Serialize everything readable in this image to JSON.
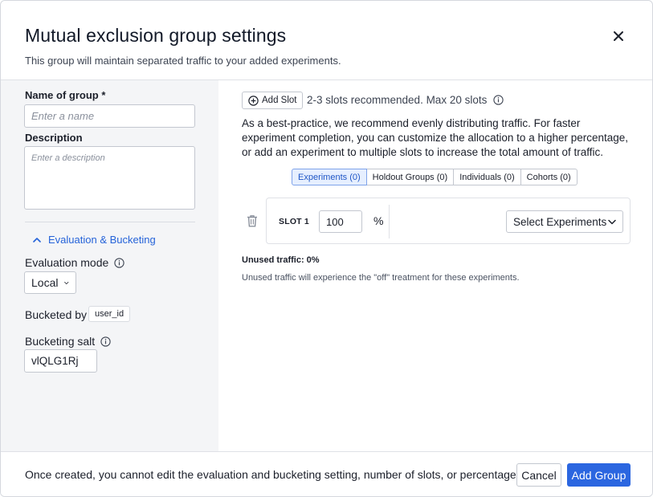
{
  "dialog": {
    "title": "Mutual exclusion group settings",
    "subtitle": "This group will maintain separated traffic to your added experiments.",
    "close_icon": "close-icon"
  },
  "left_panel": {
    "name_label": "Name of group *",
    "name_value": "",
    "name_placeholder": "Enter a name",
    "description_label": "Description",
    "description_value": "",
    "description_placeholder": "Enter a description",
    "section_toggle_label": "Evaluation & Bucketing",
    "section_toggle_icon": "chevron-up-icon",
    "evaluation_mode_label": "Evaluation mode",
    "evaluation_mode_value": "Local",
    "bucketed_by_label": "Bucketed by",
    "bucketed_by_value": "user_id",
    "bucketing_salt_label": "Bucketing salt",
    "bucketing_salt_value": "vlQLG1Rj"
  },
  "right_panel": {
    "add_slot_label": "Add Slot",
    "add_slot_icon": "plus-circle-icon",
    "slots_hint": "2-3 slots recommended. Max 20 slots",
    "description": "As a best-practice, we recommend evenly distributing traffic. For faster experiment completion, you can customize the allocation to a higher percentage, or add an experiment to multiple slots to increase the total amount of traffic.",
    "tabs": [
      {
        "label": "Experiments (0)",
        "active": true
      },
      {
        "label": "Holdout Groups (0)",
        "active": false
      },
      {
        "label": "Individuals (0)",
        "active": false
      },
      {
        "label": "Cohorts (0)",
        "active": false
      }
    ],
    "slots": [
      {
        "label": "SLOT 1",
        "percent": "100",
        "percent_symbol": "%",
        "select_label": "Select Experiments"
      }
    ],
    "unused_traffic": "Unused traffic: 0%",
    "unused_note": "Unused traffic will experience the \"off\" treatment for these experiments."
  },
  "footer": {
    "note": "Once created, you cannot edit the evaluation and bucketing setting, number of slots, or percentages.",
    "cancel_label": "Cancel",
    "submit_label": "Add Group"
  },
  "colors": {
    "accent": "#2b66e0",
    "link": "#2563d9",
    "left_panel_bg": "#f4f5f7",
    "active_tab_bg": "#e6efff"
  }
}
